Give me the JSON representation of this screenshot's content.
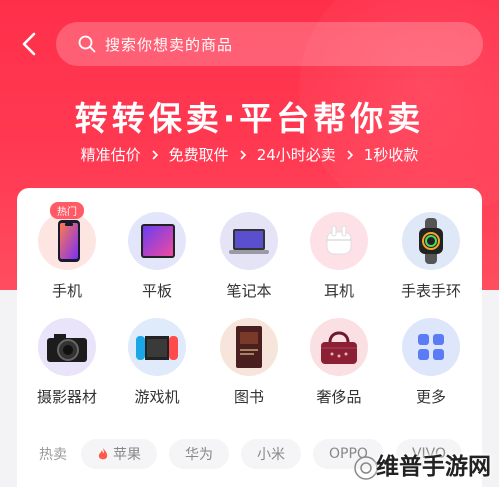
{
  "header": {
    "search": {
      "placeholder": "搜索你想卖的商品"
    },
    "headline": "转转保卖·平台帮你卖",
    "features": [
      "精准估价",
      "免费取件",
      "24小时必卖",
      "1秒收款"
    ]
  },
  "categories": [
    {
      "label": "手机",
      "icon": "phone-icon",
      "badge": "热门"
    },
    {
      "label": "平板",
      "icon": "tablet-icon"
    },
    {
      "label": "笔记本",
      "icon": "laptop-icon"
    },
    {
      "label": "耳机",
      "icon": "earphones-icon"
    },
    {
      "label": "手表手环",
      "icon": "watch-icon"
    },
    {
      "label": "摄影器材",
      "icon": "camera-icon"
    },
    {
      "label": "游戏机",
      "icon": "game-console-icon"
    },
    {
      "label": "图书",
      "icon": "book-icon"
    },
    {
      "label": "奢侈品",
      "icon": "handbag-icon"
    },
    {
      "label": "更多",
      "icon": "more-grid-icon"
    }
  ],
  "hot": {
    "title": "热卖",
    "chips": [
      "苹果",
      "华为",
      "小米",
      "OPPO",
      "VIVO"
    ]
  },
  "watermark": "维普手游网",
  "colors": {
    "primary": "#ff3a52",
    "badge": "#ff5a66"
  }
}
